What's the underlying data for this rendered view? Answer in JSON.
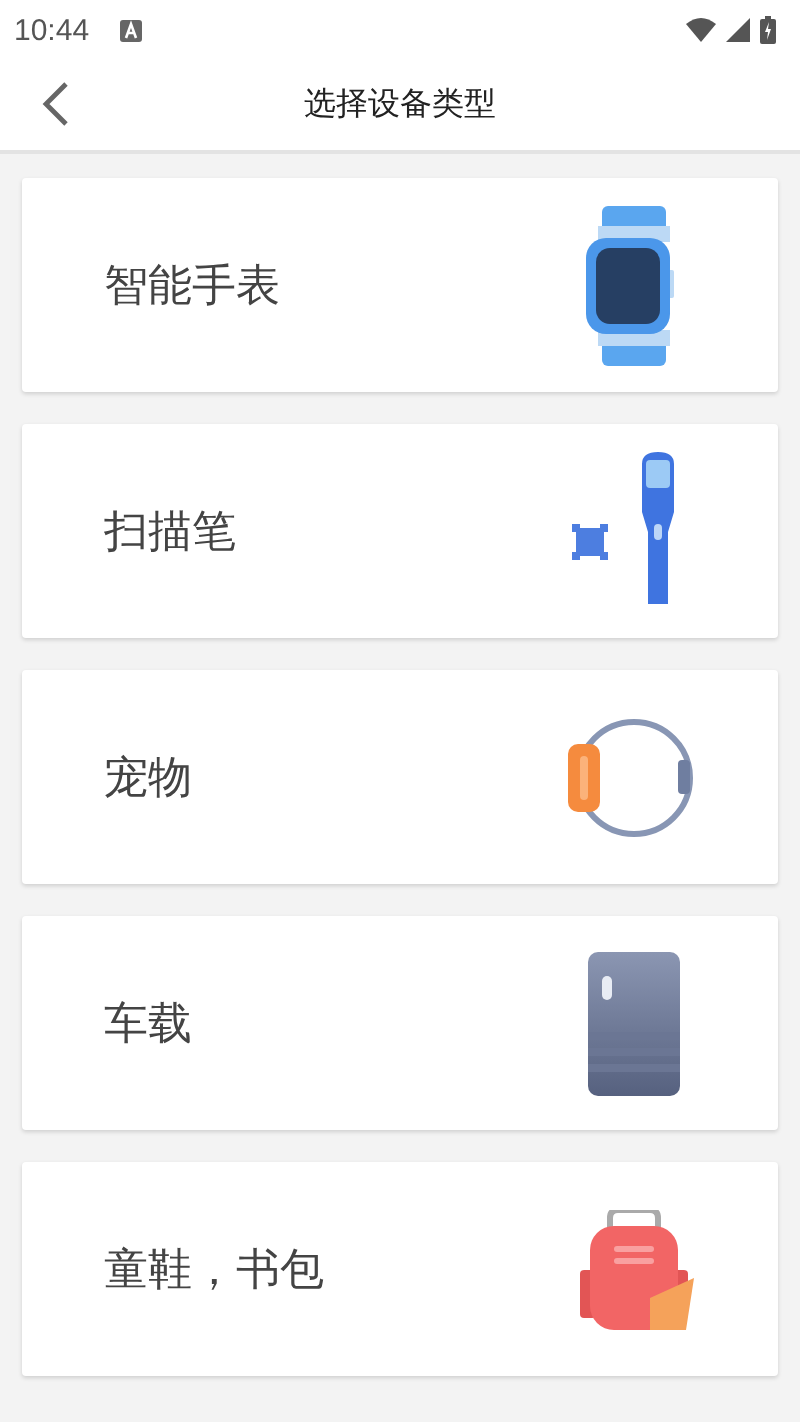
{
  "status_bar": {
    "time": "10:44"
  },
  "header": {
    "title": "选择设备类型"
  },
  "devices": [
    {
      "label": "智能手表",
      "kind": "watch"
    },
    {
      "label": "扫描笔",
      "kind": "scanner"
    },
    {
      "label": "宠物",
      "kind": "pet"
    },
    {
      "label": "车载",
      "kind": "car"
    },
    {
      "label": "童鞋，书包",
      "kind": "bag"
    }
  ]
}
